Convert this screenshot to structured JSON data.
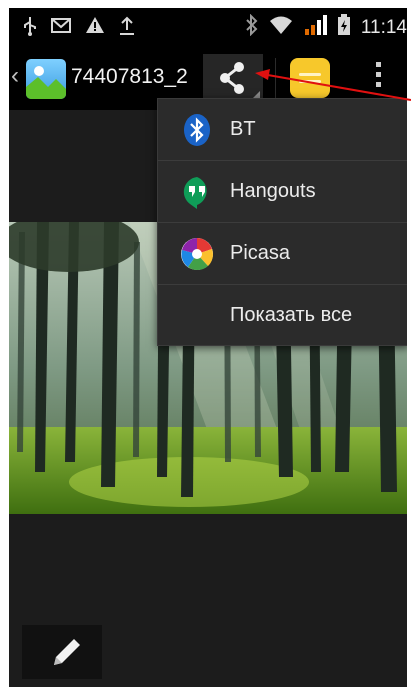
{
  "status_bar": {
    "time": "11:14",
    "icons": [
      "usb-icon",
      "mail-icon",
      "warning-icon",
      "upload-icon",
      "bluetooth-icon",
      "wifi-icon",
      "signal-icon",
      "battery-charging-icon"
    ]
  },
  "action_bar": {
    "title": "74407813_2",
    "icons": [
      "back-chevron-icon",
      "gallery-app-icon",
      "share-icon",
      "notes-icon",
      "overflow-menu-icon"
    ]
  },
  "share_menu": {
    "items": [
      {
        "label": "BT",
        "icon": "bluetooth-icon"
      },
      {
        "label": "Hangouts",
        "icon": "hangouts-icon"
      },
      {
        "label": "Picasa",
        "icon": "picasa-icon"
      },
      {
        "label": "Показать все",
        "icon": ""
      }
    ]
  },
  "photo": {
    "subject": "forest-photo"
  },
  "bottom": {
    "icons": [
      "pencil-icon"
    ]
  },
  "colors": {
    "screen_bg": "#1c1c1c",
    "bar_bg": "#000000",
    "menu_bg": "#2b2b2b",
    "annotation_arrow": "#e01010",
    "hangouts_green": "#0f9d58",
    "bluetooth_blue": "#1a63c7",
    "notes_yellow": "#f7c82b"
  }
}
